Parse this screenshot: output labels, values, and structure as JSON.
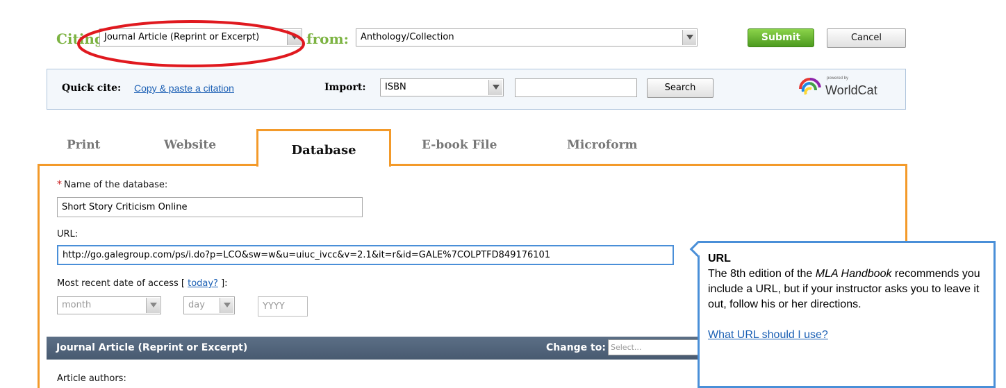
{
  "header": {
    "citing_label": "Citing:",
    "citing_select": "Journal Article (Reprint or Excerpt)",
    "from_label": "from:",
    "from_select": "Anthology/Collection",
    "submit_label": "Submit",
    "cancel_label": "Cancel"
  },
  "quick_cite": {
    "label": "Quick cite:",
    "link": "Copy & paste a citation",
    "import_label": "Import:",
    "import_select": "ISBN",
    "import_value": "",
    "search_label": "Search",
    "powered_by": "powered by",
    "worldcat": "WorldCat"
  },
  "tabs": [
    {
      "label": "Print"
    },
    {
      "label": "Website"
    },
    {
      "label": "Database"
    },
    {
      "label": "E-book File"
    },
    {
      "label": "Microform"
    }
  ],
  "form": {
    "required_marker": "*",
    "db_name_label": "Name of the database:",
    "db_name_value": "Short Story Criticism Online",
    "url_label": "URL:",
    "url_value": "http://go.galegroup.com/ps/i.do?p=LCO&sw=w&u=uiuc_ivcc&v=2.1&it=r&id=GALE%7COLPTFD849176101",
    "date_label_prefix": "Most recent date of access [ ",
    "today_link": "today?",
    "date_label_suffix": " ]:",
    "month_placeholder": "month",
    "day_placeholder": "day",
    "year_placeholder": "YYYY"
  },
  "section": {
    "title": "Journal Article (Reprint or Excerpt)",
    "change_label": "Change to:",
    "change_select": "Select..."
  },
  "authors_label": "Article authors:",
  "tooltip": {
    "title": "URL",
    "body_prefix": "The 8th edition of the ",
    "body_italic": "MLA Handbook",
    "body_suffix": " recommends you include a URL, but if your instructor asks you to leave it out, follow his or her directions.",
    "link": "What URL should I use?"
  },
  "colors": {
    "accent_green": "#7cb342",
    "tab_orange": "#f39a2a",
    "tooltip_blue": "#4a8fd8",
    "annotation_red": "#e0191f"
  }
}
